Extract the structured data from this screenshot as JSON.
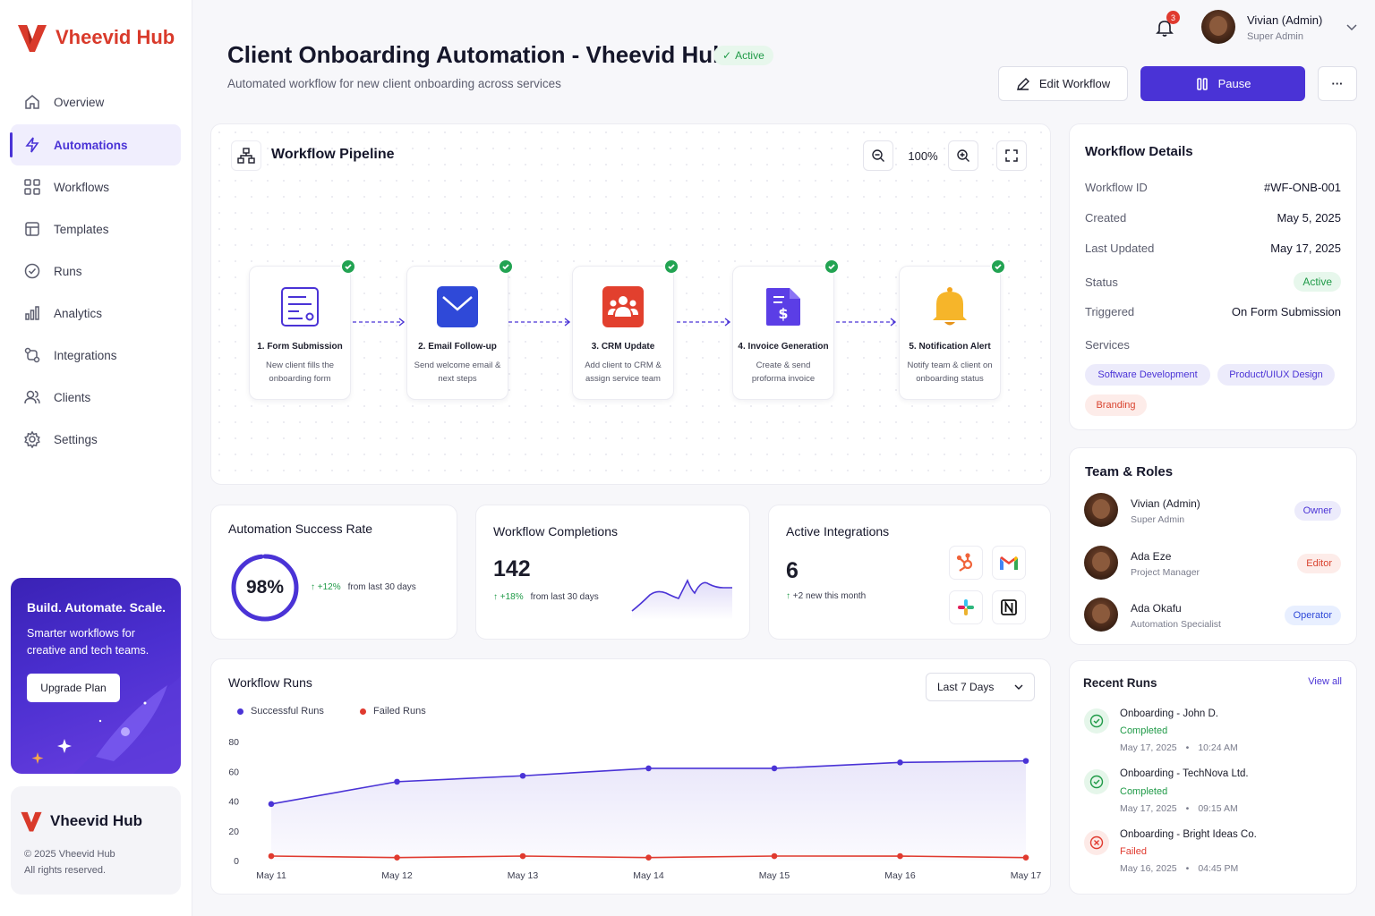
{
  "brand": {
    "name": "Vheevid Hub",
    "logo_color": "#d93a2b"
  },
  "sidebar": {
    "items": [
      {
        "label": "Overview",
        "icon": "home-icon"
      },
      {
        "label": "Automations",
        "icon": "lightning-icon",
        "active": true
      },
      {
        "label": "Workflows",
        "icon": "workflow-icon"
      },
      {
        "label": "Templates",
        "icon": "templates-icon"
      },
      {
        "label": "Runs",
        "icon": "runs-icon"
      },
      {
        "label": "Analytics",
        "icon": "analytics-icon"
      },
      {
        "label": "Integrations",
        "icon": "integrations-icon"
      },
      {
        "label": "Clients",
        "icon": "clients-icon"
      },
      {
        "label": "Settings",
        "icon": "settings-icon"
      }
    ],
    "promo": {
      "title": "Build. Automate. Scale.",
      "text": "Smarter workflows for creative and tech teams.",
      "button": "Upgrade Plan"
    },
    "footer": {
      "brand": "Vheevid Hub",
      "copyright": "© 2025 Vheevid Hub",
      "rights": "All rights reserved."
    }
  },
  "topbar": {
    "notification_count": "3",
    "user_name": "Vivian (Admin)",
    "user_role": "Super Admin"
  },
  "header": {
    "title": "Client Onboarding Automation - Vheevid Hub",
    "status": "Active",
    "subtitle": "Automated workflow for new client onboarding across services",
    "edit_label": "Edit Workflow",
    "pause_label": "Pause",
    "more_label": "···"
  },
  "pipeline": {
    "title": "Workflow Pipeline",
    "zoom": "100%",
    "steps": [
      {
        "title": "1. Form Submission",
        "desc": "New client fills the onboarding form",
        "icon": "form-icon"
      },
      {
        "title": "2. Email Follow-up",
        "desc": "Send welcome email & next steps",
        "icon": "email-icon"
      },
      {
        "title": "3. CRM Update",
        "desc": "Add client to CRM & assign service team",
        "icon": "crm-icon"
      },
      {
        "title": "4. Invoice Generation",
        "desc": "Create & send proforma invoice",
        "icon": "invoice-icon"
      },
      {
        "title": "5. Notification Alert",
        "desc": "Notify team & client on onboarding status",
        "icon": "bell-icon"
      }
    ]
  },
  "stats": {
    "success": {
      "title": "Automation Success Rate",
      "value": "98%",
      "rate": 0.98,
      "change": "+12%",
      "note": "from last 30 days"
    },
    "completions": {
      "title": "Workflow Completions",
      "value": "142",
      "change": "+18%",
      "note": "from last 30 days"
    },
    "integrations": {
      "title": "Active Integrations",
      "value": "6",
      "note": "+2 new this month"
    }
  },
  "runs_chart": {
    "title": "Workflow Runs",
    "range": "Last 7 Days",
    "legend": [
      "Successful Runs",
      "Failed Runs"
    ]
  },
  "chart_data": {
    "type": "line",
    "categories": [
      "May 11",
      "May 12",
      "May 13",
      "May 14",
      "May 15",
      "May 16",
      "May 17"
    ],
    "series": [
      {
        "name": "Successful Runs",
        "values": [
          38,
          53,
          57,
          62,
          62,
          66,
          67
        ],
        "color": "#4a33d6"
      },
      {
        "name": "Failed Runs",
        "values": [
          3,
          2,
          3,
          2,
          3,
          3,
          2
        ],
        "color": "#e03a2f"
      }
    ],
    "ylim": [
      0,
      80
    ],
    "yticks": [
      "80",
      "60",
      "40",
      "20",
      "0"
    ],
    "grid": false,
    "legend": "top-left"
  },
  "details": {
    "title": "Workflow Details",
    "rows": [
      {
        "label": "Workflow ID",
        "value": "#WF-ONB-001"
      },
      {
        "label": "Created",
        "value": "May 5, 2025"
      },
      {
        "label": "Last Updated",
        "value": "May 17, 2025"
      },
      {
        "label": "Status",
        "value": "Active"
      },
      {
        "label": "Triggered",
        "value": "On Form Submission"
      }
    ],
    "services_label": "Services",
    "services": [
      "Software Development",
      "Product/UIUX Design",
      "Branding"
    ]
  },
  "team": {
    "title": "Team & Roles",
    "members": [
      {
        "name": "Vivian (Admin)",
        "role": "Super Admin",
        "badge": "Owner"
      },
      {
        "name": "Ada Eze",
        "role": "Project Manager",
        "badge": "Editor"
      },
      {
        "name": "Ada Okafu",
        "role": "Automation Specialist",
        "badge": "Operator"
      }
    ]
  },
  "recent": {
    "title": "Recent Runs",
    "view_all": "View all",
    "runs": [
      {
        "name": "Onboarding - John D.",
        "status": "Completed",
        "date": "May 17, 2025",
        "time": "10:24 AM"
      },
      {
        "name": "Onboarding - TechNova Ltd.",
        "status": "Completed",
        "date": "May 17, 2025",
        "time": "09:15 AM"
      },
      {
        "name": "Onboarding - Bright Ideas Co.",
        "status": "Failed",
        "date": "May 16, 2025",
        "time": "04:45 PM"
      }
    ]
  }
}
